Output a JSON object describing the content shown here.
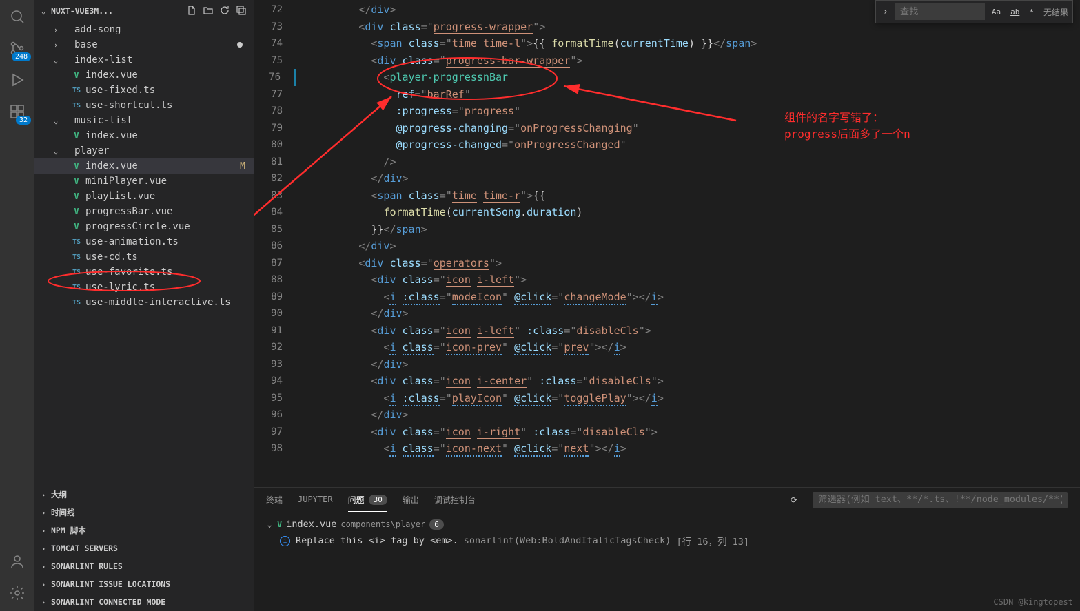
{
  "activity": {
    "badge_scm": "248",
    "badge_ext": "32"
  },
  "sidebar": {
    "title": "NUXT-VUE3M...",
    "tree": [
      {
        "depth": 1,
        "chev": ">",
        "icon": "",
        "label": "add-song"
      },
      {
        "depth": 1,
        "chev": ">",
        "icon": "",
        "label": "base",
        "mod": true
      },
      {
        "depth": 1,
        "chev": "v",
        "icon": "",
        "label": "index-list"
      },
      {
        "depth": 2,
        "chev": "",
        "icon": "vue",
        "label": "index.vue"
      },
      {
        "depth": 2,
        "chev": "",
        "icon": "ts",
        "label": "use-fixed.ts"
      },
      {
        "depth": 2,
        "chev": "",
        "icon": "ts",
        "label": "use-shortcut.ts"
      },
      {
        "depth": 1,
        "chev": "v",
        "icon": "",
        "label": "music-list"
      },
      {
        "depth": 2,
        "chev": "",
        "icon": "vue",
        "label": "index.vue"
      },
      {
        "depth": 1,
        "chev": "v",
        "icon": "",
        "label": "player"
      },
      {
        "depth": 2,
        "chev": "",
        "icon": "vue",
        "label": "index.vue",
        "git": "M",
        "sel": true
      },
      {
        "depth": 2,
        "chev": "",
        "icon": "vue",
        "label": "miniPlayer.vue"
      },
      {
        "depth": 2,
        "chev": "",
        "icon": "vue",
        "label": "playList.vue"
      },
      {
        "depth": 2,
        "chev": "",
        "icon": "vue",
        "label": "progressBar.vue"
      },
      {
        "depth": 2,
        "chev": "",
        "icon": "vue",
        "label": "progressCircle.vue"
      },
      {
        "depth": 2,
        "chev": "",
        "icon": "ts",
        "label": "use-animation.ts"
      },
      {
        "depth": 2,
        "chev": "",
        "icon": "ts",
        "label": "use-cd.ts"
      },
      {
        "depth": 2,
        "chev": "",
        "icon": "ts",
        "label": "use-favorite.ts"
      },
      {
        "depth": 2,
        "chev": "",
        "icon": "ts",
        "label": "use-lyric.ts"
      },
      {
        "depth": 2,
        "chev": "",
        "icon": "ts",
        "label": "use-middle-interactive.ts"
      }
    ],
    "panels": [
      "大纲",
      "时间线",
      "NPM 脚本",
      "TOMCAT SERVERS",
      "SONARLINT RULES",
      "SONARLINT ISSUE LOCATIONS",
      "SONARLINT CONNECTED MODE"
    ]
  },
  "find": {
    "placeholder": "查找",
    "opts": [
      "Aa",
      "ab",
      "*"
    ],
    "result": "无结果"
  },
  "code": {
    "lines": [
      {
        "n": 72,
        "h": "          <span class='punc'>&lt;/</span><span class='tag'>div</span><span class='punc'>&gt;</span>"
      },
      {
        "n": 73,
        "h": "          <span class='punc'>&lt;</span><span class='tag'>div</span> <span class='attr'>class</span><span class='punc'>=</span><span class='punc'>\"</span><span class='str-u'>progress-wrapper</span><span class='punc'>\"</span><span class='punc'>&gt;</span>"
      },
      {
        "n": 74,
        "h": "            <span class='punc'>&lt;</span><span class='tag'>span</span> <span class='attr'>class</span><span class='punc'>=\"</span><span class='str-u'>time</span> <span class='str-u'>time-l</span><span class='punc'>\"&gt;</span><span class='mustache'>{{ </span><span class='func'>formatTime</span><span class='mustache'>(</span><span class='var'>currentTime</span><span class='mustache'>) }}</span><span class='punc'>&lt;/</span><span class='tag'>span</span><span class='punc'>&gt;</span>"
      },
      {
        "n": 75,
        "h": "            <span class='punc'>&lt;</span><span class='tag'>div</span> <span class='attr'>class</span><span class='punc'>=\"</span><span class='str-u'>progress-bar-wrapper</span><span class='punc'>\"&gt;</span>"
      },
      {
        "n": 76,
        "mod": true,
        "h": "              <span class='punc'>&lt;</span><span class='cmp-tag'>player-progressnBar</span>"
      },
      {
        "n": 77,
        "h": "                <span class='attr'>ref</span><span class='punc'>=\"</span><span class='str'>barRef</span><span class='punc'>\"</span>"
      },
      {
        "n": 78,
        "h": "                <span class='attr'>:progress</span><span class='punc'>=\"</span><span class='str'>progress</span><span class='punc'>\"</span>"
      },
      {
        "n": 79,
        "h": "                <span class='attr'>@progress-changing</span><span class='punc'>=\"</span><span class='str'>onProgressChanging</span><span class='punc'>\"</span>"
      },
      {
        "n": 80,
        "h": "                <span class='attr'>@progress-changed</span><span class='punc'>=\"</span><span class='str'>onProgressChanged</span><span class='punc'>\"</span>"
      },
      {
        "n": 81,
        "h": "              <span class='punc'>/&gt;</span>"
      },
      {
        "n": 82,
        "h": "            <span class='punc'>&lt;/</span><span class='tag'>div</span><span class='punc'>&gt;</span>"
      },
      {
        "n": 83,
        "h": "            <span class='punc'>&lt;</span><span class='tag'>span</span> <span class='attr'>class</span><span class='punc'>=\"</span><span class='str-u'>time</span> <span class='str-u'>time-r</span><span class='punc'>\"&gt;</span><span class='mustache'>{{</span>"
      },
      {
        "n": 84,
        "h": "              <span class='func'>formatTime</span><span class='mustache'>(</span><span class='var'>currentSong</span><span class='mustache'>.</span><span class='var'>duration</span><span class='mustache'>)</span>"
      },
      {
        "n": 85,
        "h": "            <span class='mustache'>}}</span><span class='punc'>&lt;/</span><span class='tag'>span</span><span class='punc'>&gt;</span>"
      },
      {
        "n": 86,
        "h": "          <span class='punc'>&lt;/</span><span class='tag'>div</span><span class='punc'>&gt;</span>"
      },
      {
        "n": 87,
        "h": "          <span class='punc'>&lt;</span><span class='tag'>div</span> <span class='attr'>class</span><span class='punc'>=\"</span><span class='str-u'>operators</span><span class='punc'>\"&gt;</span>"
      },
      {
        "n": 88,
        "h": "            <span class='punc'>&lt;</span><span class='tag'>div</span> <span class='attr'>class</span><span class='punc'>=\"</span><span class='str-u'>icon</span> <span class='str-u'>i-left</span><span class='punc'>\"&gt;</span>"
      },
      {
        "n": 89,
        "h": "              <span class='punc'>&lt;</span><span class='tag squiggle'>i</span> <span class='attr squiggle'>:class</span><span class='punc'>=\"</span><span class='str squiggle'>modeIcon</span><span class='punc'>\"</span> <span class='attr squiggle'>@click</span><span class='punc'>=\"</span><span class='str squiggle'>changeMode</span><span class='punc'>\"&gt;&lt;/</span><span class='tag squiggle'>i</span><span class='punc'>&gt;</span>"
      },
      {
        "n": 90,
        "h": "            <span class='punc'>&lt;/</span><span class='tag'>div</span><span class='punc'>&gt;</span>"
      },
      {
        "n": 91,
        "h": "            <span class='punc'>&lt;</span><span class='tag'>div</span> <span class='attr'>class</span><span class='punc'>=\"</span><span class='str-u'>icon</span> <span class='str-u'>i-left</span><span class='punc'>\"</span> <span class='attr'>:class</span><span class='punc'>=\"</span><span class='str'>disableCls</span><span class='punc'>\"&gt;</span>"
      },
      {
        "n": 92,
        "h": "              <span class='punc'>&lt;</span><span class='tag squiggle'>i</span> <span class='attr squiggle'>class</span><span class='punc'>=\"</span><span class='str-u squiggle'>icon-prev</span><span class='punc'>\"</span> <span class='attr squiggle'>@click</span><span class='punc'>=\"</span><span class='str squiggle'>prev</span><span class='punc'>\"&gt;&lt;/</span><span class='tag squiggle'>i</span><span class='punc'>&gt;</span>"
      },
      {
        "n": 93,
        "h": "            <span class='punc'>&lt;/</span><span class='tag'>div</span><span class='punc'>&gt;</span>"
      },
      {
        "n": 94,
        "h": "            <span class='punc'>&lt;</span><span class='tag'>div</span> <span class='attr'>class</span><span class='punc'>=\"</span><span class='str-u'>icon</span> <span class='str-u'>i-center</span><span class='punc'>\"</span> <span class='attr'>:class</span><span class='punc'>=\"</span><span class='str'>disableCls</span><span class='punc'>\"&gt;</span>"
      },
      {
        "n": 95,
        "h": "              <span class='punc'>&lt;</span><span class='tag squiggle'>i</span> <span class='attr squiggle'>:class</span><span class='punc'>=\"</span><span class='str squiggle'>playIcon</span><span class='punc'>\"</span> <span class='attr squiggle'>@click</span><span class='punc'>=\"</span><span class='str squiggle'>togglePlay</span><span class='punc'>\"&gt;&lt;/</span><span class='tag squiggle'>i</span><span class='punc'>&gt;</span>"
      },
      {
        "n": 96,
        "h": "            <span class='punc'>&lt;/</span><span class='tag'>div</span><span class='punc'>&gt;</span>"
      },
      {
        "n": 97,
        "h": "            <span class='punc'>&lt;</span><span class='tag'>div</span> <span class='attr'>class</span><span class='punc'>=\"</span><span class='str-u'>icon</span> <span class='str-u'>i-right</span><span class='punc'>\"</span> <span class='attr'>:class</span><span class='punc'>=\"</span><span class='str'>disableCls</span><span class='punc'>\"&gt;</span>"
      },
      {
        "n": 98,
        "h": "              <span class='punc'>&lt;</span><span class='tag squiggle'>i</span> <span class='attr squiggle'>class</span><span class='punc'>=\"</span><span class='str-u squiggle'>icon-next</span><span class='punc'>\"</span> <span class='attr squiggle'>@click</span><span class='punc'>=\"</span><span class='str squiggle'>next</span><span class='punc'>\"&gt;&lt;/</span><span class='tag squiggle'>i</span><span class='punc'>&gt;</span>"
      }
    ]
  },
  "panel": {
    "tabs": [
      {
        "label": "终端"
      },
      {
        "label": "JUPYTER"
      },
      {
        "label": "问题",
        "count": "30",
        "active": true
      },
      {
        "label": "输出"
      },
      {
        "label": "调试控制台"
      }
    ],
    "filter_ph": "筛选器(例如 text、**/*.ts、!**/node_modules/**)",
    "file": {
      "name": "index.vue",
      "path": "components\\player",
      "count": "6"
    },
    "problem": {
      "msg": "Replace this <i> tag by <em>.",
      "rule": "sonarlint(Web:BoldAndItalicTagsCheck)",
      "loc": "[行 16，列 13]"
    }
  },
  "annotation": {
    "line1": "组件的名字写错了：",
    "line2": "progress后面多了一个n"
  },
  "watermark": "CSDN @kingtopest"
}
